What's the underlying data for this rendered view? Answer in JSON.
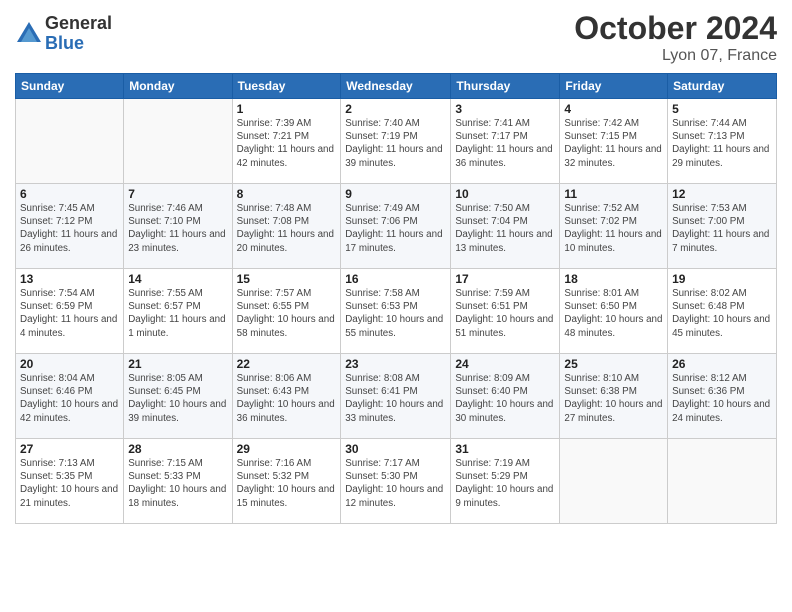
{
  "header": {
    "logo_general": "General",
    "logo_blue": "Blue",
    "month_title": "October 2024",
    "location": "Lyon 07, France"
  },
  "weekdays": [
    "Sunday",
    "Monday",
    "Tuesday",
    "Wednesday",
    "Thursday",
    "Friday",
    "Saturday"
  ],
  "weeks": [
    [
      {
        "day": "",
        "info": ""
      },
      {
        "day": "",
        "info": ""
      },
      {
        "day": "1",
        "info": "Sunrise: 7:39 AM\nSunset: 7:21 PM\nDaylight: 11 hours and 42 minutes."
      },
      {
        "day": "2",
        "info": "Sunrise: 7:40 AM\nSunset: 7:19 PM\nDaylight: 11 hours and 39 minutes."
      },
      {
        "day": "3",
        "info": "Sunrise: 7:41 AM\nSunset: 7:17 PM\nDaylight: 11 hours and 36 minutes."
      },
      {
        "day": "4",
        "info": "Sunrise: 7:42 AM\nSunset: 7:15 PM\nDaylight: 11 hours and 32 minutes."
      },
      {
        "day": "5",
        "info": "Sunrise: 7:44 AM\nSunset: 7:13 PM\nDaylight: 11 hours and 29 minutes."
      }
    ],
    [
      {
        "day": "6",
        "info": "Sunrise: 7:45 AM\nSunset: 7:12 PM\nDaylight: 11 hours and 26 minutes."
      },
      {
        "day": "7",
        "info": "Sunrise: 7:46 AM\nSunset: 7:10 PM\nDaylight: 11 hours and 23 minutes."
      },
      {
        "day": "8",
        "info": "Sunrise: 7:48 AM\nSunset: 7:08 PM\nDaylight: 11 hours and 20 minutes."
      },
      {
        "day": "9",
        "info": "Sunrise: 7:49 AM\nSunset: 7:06 PM\nDaylight: 11 hours and 17 minutes."
      },
      {
        "day": "10",
        "info": "Sunrise: 7:50 AM\nSunset: 7:04 PM\nDaylight: 11 hours and 13 minutes."
      },
      {
        "day": "11",
        "info": "Sunrise: 7:52 AM\nSunset: 7:02 PM\nDaylight: 11 hours and 10 minutes."
      },
      {
        "day": "12",
        "info": "Sunrise: 7:53 AM\nSunset: 7:00 PM\nDaylight: 11 hours and 7 minutes."
      }
    ],
    [
      {
        "day": "13",
        "info": "Sunrise: 7:54 AM\nSunset: 6:59 PM\nDaylight: 11 hours and 4 minutes."
      },
      {
        "day": "14",
        "info": "Sunrise: 7:55 AM\nSunset: 6:57 PM\nDaylight: 11 hours and 1 minute."
      },
      {
        "day": "15",
        "info": "Sunrise: 7:57 AM\nSunset: 6:55 PM\nDaylight: 10 hours and 58 minutes."
      },
      {
        "day": "16",
        "info": "Sunrise: 7:58 AM\nSunset: 6:53 PM\nDaylight: 10 hours and 55 minutes."
      },
      {
        "day": "17",
        "info": "Sunrise: 7:59 AM\nSunset: 6:51 PM\nDaylight: 10 hours and 51 minutes."
      },
      {
        "day": "18",
        "info": "Sunrise: 8:01 AM\nSunset: 6:50 PM\nDaylight: 10 hours and 48 minutes."
      },
      {
        "day": "19",
        "info": "Sunrise: 8:02 AM\nSunset: 6:48 PM\nDaylight: 10 hours and 45 minutes."
      }
    ],
    [
      {
        "day": "20",
        "info": "Sunrise: 8:04 AM\nSunset: 6:46 PM\nDaylight: 10 hours and 42 minutes."
      },
      {
        "day": "21",
        "info": "Sunrise: 8:05 AM\nSunset: 6:45 PM\nDaylight: 10 hours and 39 minutes."
      },
      {
        "day": "22",
        "info": "Sunrise: 8:06 AM\nSunset: 6:43 PM\nDaylight: 10 hours and 36 minutes."
      },
      {
        "day": "23",
        "info": "Sunrise: 8:08 AM\nSunset: 6:41 PM\nDaylight: 10 hours and 33 minutes."
      },
      {
        "day": "24",
        "info": "Sunrise: 8:09 AM\nSunset: 6:40 PM\nDaylight: 10 hours and 30 minutes."
      },
      {
        "day": "25",
        "info": "Sunrise: 8:10 AM\nSunset: 6:38 PM\nDaylight: 10 hours and 27 minutes."
      },
      {
        "day": "26",
        "info": "Sunrise: 8:12 AM\nSunset: 6:36 PM\nDaylight: 10 hours and 24 minutes."
      }
    ],
    [
      {
        "day": "27",
        "info": "Sunrise: 7:13 AM\nSunset: 5:35 PM\nDaylight: 10 hours and 21 minutes."
      },
      {
        "day": "28",
        "info": "Sunrise: 7:15 AM\nSunset: 5:33 PM\nDaylight: 10 hours and 18 minutes."
      },
      {
        "day": "29",
        "info": "Sunrise: 7:16 AM\nSunset: 5:32 PM\nDaylight: 10 hours and 15 minutes."
      },
      {
        "day": "30",
        "info": "Sunrise: 7:17 AM\nSunset: 5:30 PM\nDaylight: 10 hours and 12 minutes."
      },
      {
        "day": "31",
        "info": "Sunrise: 7:19 AM\nSunset: 5:29 PM\nDaylight: 10 hours and 9 minutes."
      },
      {
        "day": "",
        "info": ""
      },
      {
        "day": "",
        "info": ""
      }
    ]
  ]
}
